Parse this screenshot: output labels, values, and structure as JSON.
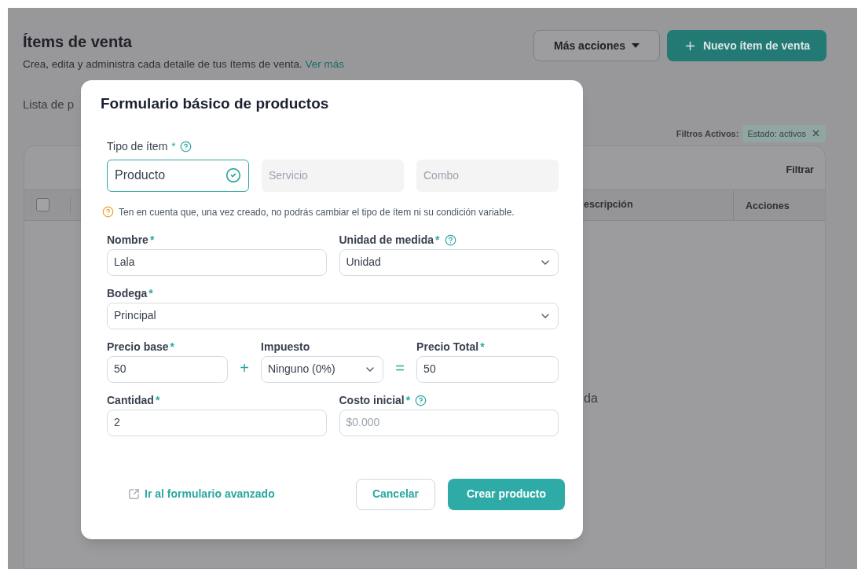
{
  "page": {
    "title": "Ítems de venta",
    "subtitle": "Crea, edita y administra cada detalle de tus ítems de venta.",
    "subtitle_link": "Ver más",
    "more_actions": "Más acciones",
    "new_item": "Nuevo ítem de venta",
    "list_label": "Lista de p",
    "filters_label": "Filtros Activos:",
    "filter_chip": "Estado: activos",
    "filter_button": "Filtrar",
    "select_all": {
      "checked": false
    },
    "columns": [
      {
        "label": "escripción"
      },
      {
        "label": "Acciones"
      }
    ],
    "empty_text": "da"
  },
  "modal": {
    "title": "Formulario básico de productos",
    "item_type": {
      "label": "Tipo de ítem",
      "required": "*",
      "help": true,
      "options": [
        {
          "label": "Producto",
          "selected": true
        },
        {
          "label": "Servicio",
          "selected": false
        },
        {
          "label": "Combo",
          "selected": false
        }
      ]
    },
    "notice": "Ten en cuenta que, una vez creado, no podrás cambiar el tipo de ítem ni su condición variable.",
    "rows": [
      [
        {
          "kind": "text",
          "label": "Nombre",
          "required": "*",
          "value": "Lala"
        },
        {
          "kind": "select",
          "label": "Unidad de medida",
          "required": "*",
          "help": true,
          "value": "Unidad"
        }
      ],
      [
        {
          "kind": "select",
          "label": "Bodega",
          "required": "*",
          "value": "Principal"
        }
      ],
      [
        {
          "kind": "text",
          "label": "Precio base",
          "required": "*",
          "value": "50"
        },
        {
          "kind": "operator",
          "symbol": "+"
        },
        {
          "kind": "select",
          "label": "Impuesto",
          "value": "Ninguno (0%)"
        },
        {
          "kind": "operator",
          "symbol": "="
        },
        {
          "kind": "text",
          "label": "Precio Total",
          "required": "*",
          "value": "50"
        }
      ],
      [
        {
          "kind": "text",
          "label": "Cantidad",
          "required": "*",
          "value": "2"
        },
        {
          "kind": "text",
          "label": "Costo inicial",
          "required": "*",
          "help": true,
          "placeholder": "$0.000"
        }
      ]
    ],
    "advanced_link": "Ir al formulario avanzado",
    "cancel": "Cancelar",
    "submit": "Crear producto"
  }
}
